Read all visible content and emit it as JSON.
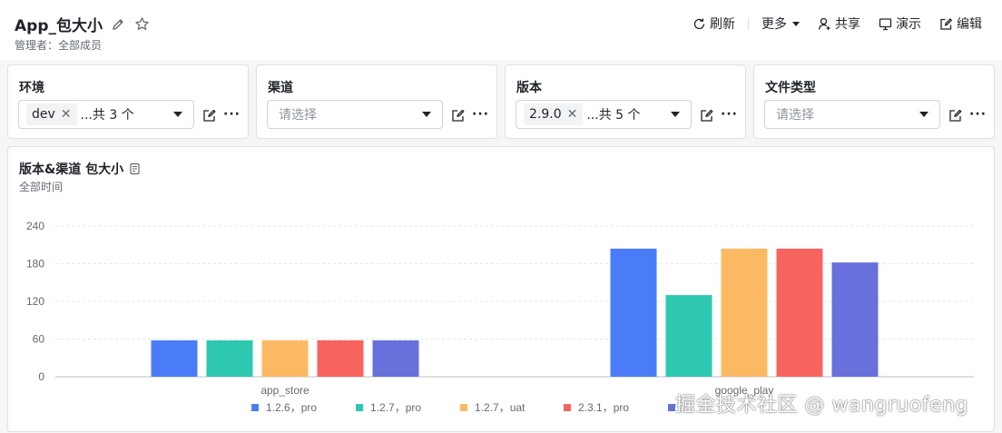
{
  "header": {
    "title": "App_包大小",
    "subtitle": "管理者：全部成员",
    "toolbar": {
      "refresh": "刷新",
      "more": "更多",
      "share": "共享",
      "present": "演示",
      "edit": "编辑"
    }
  },
  "filters": [
    {
      "label": "环境",
      "tag": "dev",
      "count": "...共 3 个",
      "placeholder": ""
    },
    {
      "label": "渠道",
      "tag": "",
      "count": "",
      "placeholder": "请选择"
    },
    {
      "label": "版本",
      "tag": "2.9.0",
      "count": "...共 5 个",
      "placeholder": ""
    },
    {
      "label": "文件类型",
      "tag": "",
      "count": "",
      "placeholder": "请选择"
    }
  ],
  "chart_card": {
    "title": "版本&渠道 包大小",
    "subtitle": "全部时间"
  },
  "watermark": "掘金技术社区 @ wangruofeng",
  "chart_data": {
    "type": "bar",
    "categories": [
      "app_store",
      "google_play"
    ],
    "ylim": [
      0,
      240
    ],
    "yticks": [
      0,
      60,
      120,
      180,
      240
    ],
    "grid": true,
    "legend_position": "bottom",
    "series": [
      {
        "name": "1.2.6，pro",
        "color": "#4a7cf7",
        "values": [
          58,
          204
        ]
      },
      {
        "name": "1.2.7，pro",
        "color": "#2ec7b0",
        "values": [
          58,
          130
        ]
      },
      {
        "name": "1.2.7，uat",
        "color": "#fcb963",
        "values": [
          58,
          204
        ]
      },
      {
        "name": "2.3.1，pro",
        "color": "#f7635f",
        "values": [
          58,
          204
        ]
      },
      {
        "name": "",
        "color": "#6870db",
        "values": [
          58,
          182
        ]
      }
    ]
  }
}
